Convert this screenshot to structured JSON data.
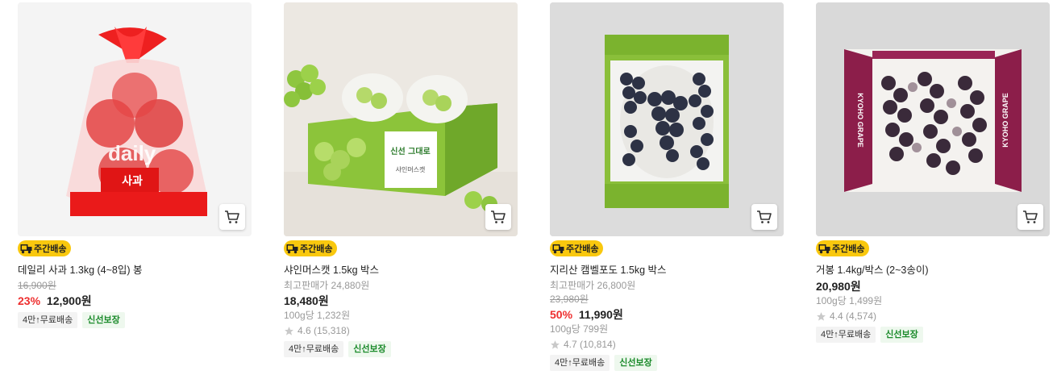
{
  "products": [
    {
      "badge": "주간배송",
      "name": "데일리 사과 1.3kg (4~8입) 봉",
      "original_price": "16,900원",
      "discount": "23%",
      "price": "12,900원",
      "chips": [
        "4만↑무료배송",
        "신선보장"
      ],
      "bag_brand": "daily",
      "bag_label": "사과"
    },
    {
      "badge": "주간배송",
      "name": "샤인머스캣 1.5kg 박스",
      "highest_price": "최고판매가 24,880원",
      "price": "18,480원",
      "unit_price": "100g당 1,232원",
      "rating": "4.6 (15,318)",
      "chips": [
        "4만↑무료배송",
        "신선보장"
      ],
      "box_label": "신선 그대로",
      "box_subtitle": "샤인머스캣"
    },
    {
      "badge": "주간배송",
      "name": "지리산 캠벨포도 1.5kg 박스",
      "highest_price": "최고판매가 26,800원",
      "original_price": "23,980원",
      "discount": "50%",
      "price": "11,990원",
      "unit_price": "100g당 799원",
      "rating": "4.7 (10,814)",
      "chips": [
        "4만↑무료배송",
        "신선보장"
      ]
    },
    {
      "badge": "주간배송",
      "name": "거봉 1.4kg/박스 (2~3송이)",
      "price": "20,980원",
      "unit_price": "100g당 1,499원",
      "rating": "4.4 (4,574)",
      "chips": [
        "4만↑무료배송",
        "신선보장"
      ],
      "box_side_text": "KYOHO GRAPE"
    }
  ],
  "colors": {
    "badge": "#f9c80e",
    "discount": "#ee2e2e",
    "fresh_chip_text": "#1a8a2a"
  },
  "icons": {
    "cart": "cart-icon",
    "badge": "truck-icon",
    "rating": "star-icon"
  }
}
